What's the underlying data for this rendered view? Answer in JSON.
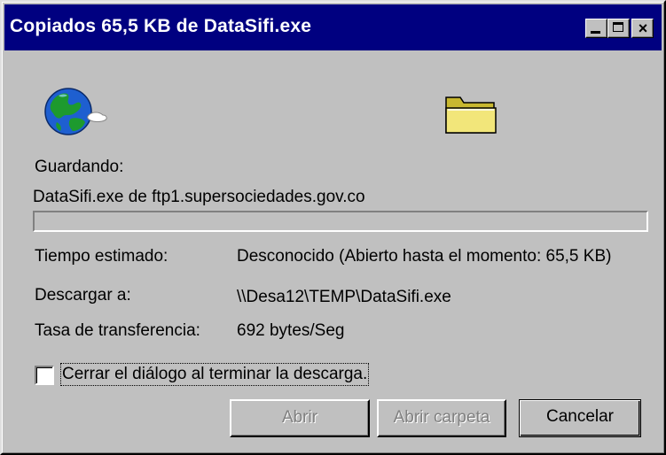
{
  "window": {
    "title": "Copiados 65,5 KB de DataSifi.exe",
    "titlebar_color": "#000080",
    "background": "#c0c0c0"
  },
  "titlebar_buttons": {
    "minimize_icon": "minimize-icon",
    "maximize_icon": "maximize-icon",
    "close_icon": "close-icon",
    "close_glyph": "×"
  },
  "icons": {
    "globe": "globe-icon",
    "folder": "folder-icon"
  },
  "saving": {
    "label": "Guardando:",
    "source": "DataSifi.exe de ftp1.supersociedades.gov.co"
  },
  "progress": {
    "fraction": 0
  },
  "details": {
    "estimated_label": "Tiempo estimado:",
    "estimated_value": "Desconocido (Abierto hasta el momento: 65,5 KB)",
    "download_to_label": "Descargar a:",
    "download_to_value": "\\\\Desa12\\TEMP\\DataSifi.exe",
    "rate_label": "Tasa de transferencia:",
    "rate_value": "692 bytes/Seg"
  },
  "close_on_finish": {
    "label": "Cerrar el diálogo al terminar la descarga.",
    "checked": false
  },
  "buttons": {
    "open": "Abrir",
    "open_folder": "Abrir carpeta",
    "cancel": "Cancelar"
  }
}
